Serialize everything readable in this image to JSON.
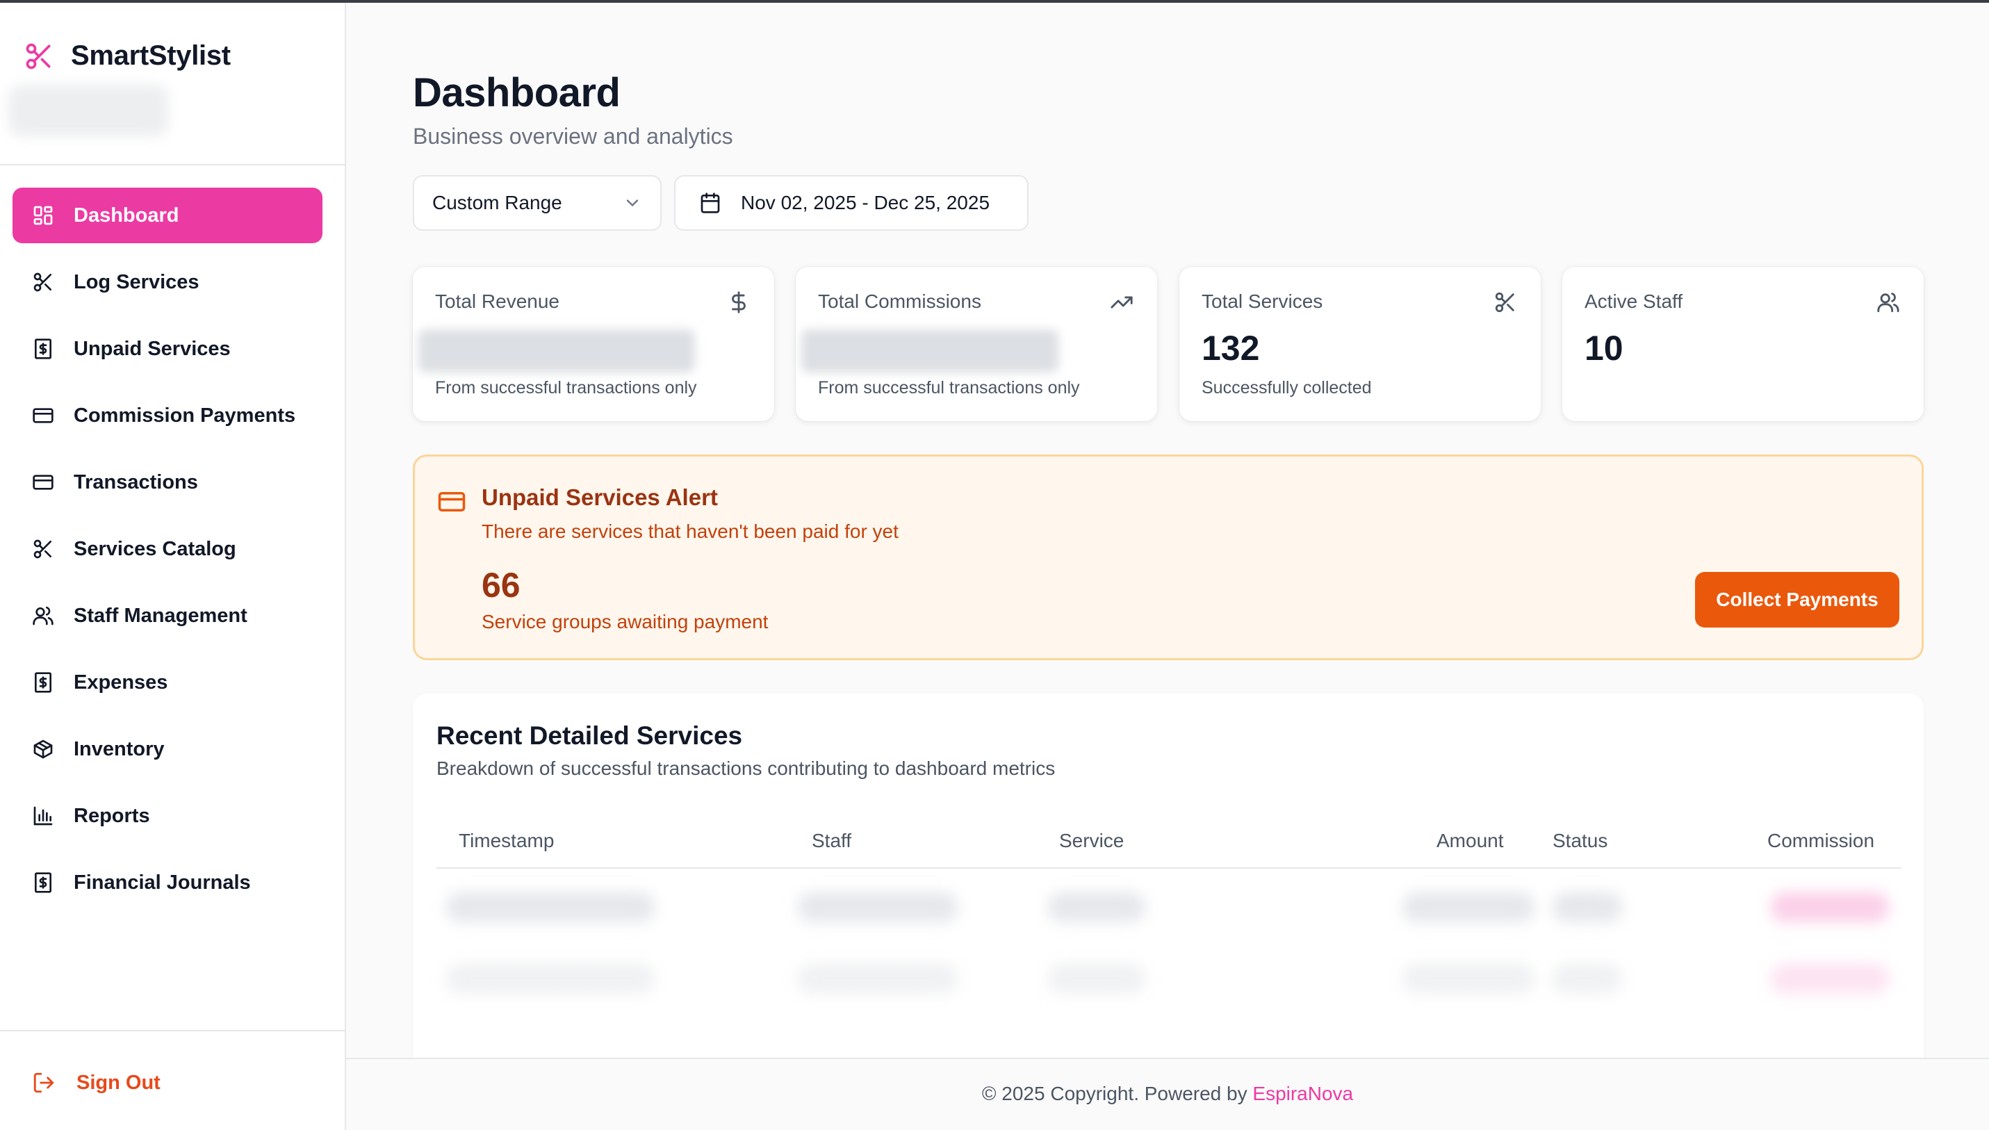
{
  "app": {
    "name": "SmartStylist",
    "brand_color": "#ec3aa3",
    "logo_icon": "scissors-icon"
  },
  "sidebar": {
    "items": [
      {
        "label": "Dashboard",
        "icon": "dashboard-grid-icon",
        "active": true
      },
      {
        "label": "Log Services",
        "icon": "scissors-icon",
        "active": false
      },
      {
        "label": "Unpaid Services",
        "icon": "receipt-dollar-icon",
        "active": false
      },
      {
        "label": "Commission Payments",
        "icon": "credit-card-icon",
        "active": false
      },
      {
        "label": "Transactions",
        "icon": "credit-card-icon",
        "active": false
      },
      {
        "label": "Services Catalog",
        "icon": "scissors-icon",
        "active": false
      },
      {
        "label": "Staff Management",
        "icon": "users-icon",
        "active": false
      },
      {
        "label": "Expenses",
        "icon": "receipt-dollar-icon",
        "active": false
      },
      {
        "label": "Inventory",
        "icon": "package-icon",
        "active": false
      },
      {
        "label": "Reports",
        "icon": "bar-chart-icon",
        "active": false
      },
      {
        "label": "Financial Journals",
        "icon": "receipt-dollar-icon",
        "active": false
      }
    ],
    "sign_out": "Sign Out",
    "sign_out_color": "#e8491b"
  },
  "page": {
    "title": "Dashboard",
    "subtitle": "Business overview and analytics"
  },
  "filters": {
    "range_selected": "Custom Range",
    "date_range": "Nov 02, 2025 - Dec 25, 2025"
  },
  "stats": [
    {
      "label": "Total Revenue",
      "icon": "dollar-icon",
      "value": "",
      "footnote": "From successful transactions only"
    },
    {
      "label": "Total Commissions",
      "icon": "trending-up-icon",
      "value": "",
      "footnote": "From successful transactions only"
    },
    {
      "label": "Total Services",
      "icon": "scissors-icon",
      "value": "132",
      "footnote": "Successfully collected"
    },
    {
      "label": "Active Staff",
      "icon": "users-icon",
      "value": "10",
      "footnote": ""
    }
  ],
  "alert": {
    "title": "Unpaid Services Alert",
    "description": "There are services that haven't been paid for yet",
    "count": "66",
    "count_label": "Service groups awaiting payment",
    "button": "Collect Payments",
    "accent_color": "#ea580c"
  },
  "recent": {
    "title": "Recent Detailed Services",
    "subtitle": "Breakdown of successful transactions contributing to dashboard metrics",
    "columns": [
      "Timestamp",
      "Staff",
      "Service",
      "Amount",
      "Status",
      "Commission"
    ]
  },
  "footer": {
    "text": "© 2025 Copyright. Powered by ",
    "link": "EspiraNova"
  }
}
